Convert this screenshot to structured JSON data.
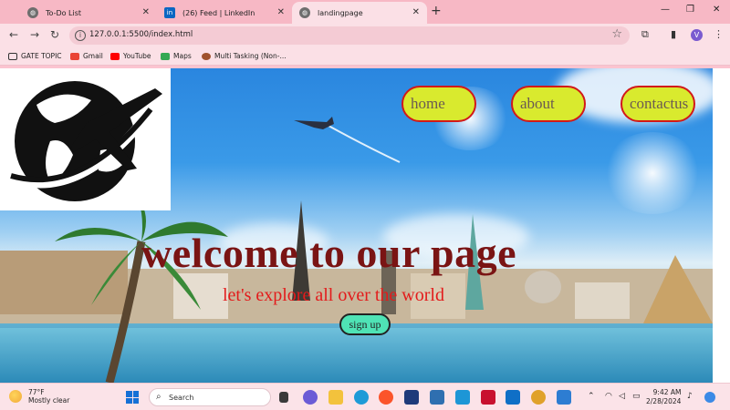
{
  "browser": {
    "tabs": [
      {
        "title": "To-Do List",
        "icon": "globe-icon",
        "active": false
      },
      {
        "title": "(26) Feed | LinkedIn",
        "icon": "linkedin-icon",
        "active": false
      },
      {
        "title": "landingpage",
        "icon": "globe-icon",
        "active": true
      }
    ],
    "new_tab_glyph": "+",
    "url": "127.0.0.1:5500/index.html",
    "profile_initial": "V",
    "bookmarks": [
      {
        "label": "GATE TOPIC",
        "icon": "folder-icon",
        "color": "#ffffff"
      },
      {
        "label": "Gmail",
        "icon": "gmail-icon",
        "color": "#ea4335"
      },
      {
        "label": "YouTube",
        "icon": "youtube-icon",
        "color": "#ff0000"
      },
      {
        "label": "Maps",
        "icon": "maps-icon",
        "color": "#34a853"
      },
      {
        "label": "Multi Tasking (Non-...",
        "icon": "bookmark-page-icon",
        "color": "#a0522d"
      }
    ]
  },
  "page": {
    "nav": {
      "home": "home",
      "about": "about",
      "contact": "contactus"
    },
    "hero_title": "welcome to our page",
    "hero_subtitle": "let's explore all over the world",
    "signup_label": "sign up",
    "colors": {
      "pill_bg": "#d9ea2e",
      "pill_border": "#d21919",
      "title": "#7a1414",
      "subtitle": "#e31b1b",
      "signup_bg": "#4fe3b5"
    }
  },
  "taskbar": {
    "weather_temp": "77°F",
    "weather_desc": "Mostly clear",
    "search_placeholder": "Search",
    "time": "9:42 AM",
    "date": "2/28/2024"
  }
}
